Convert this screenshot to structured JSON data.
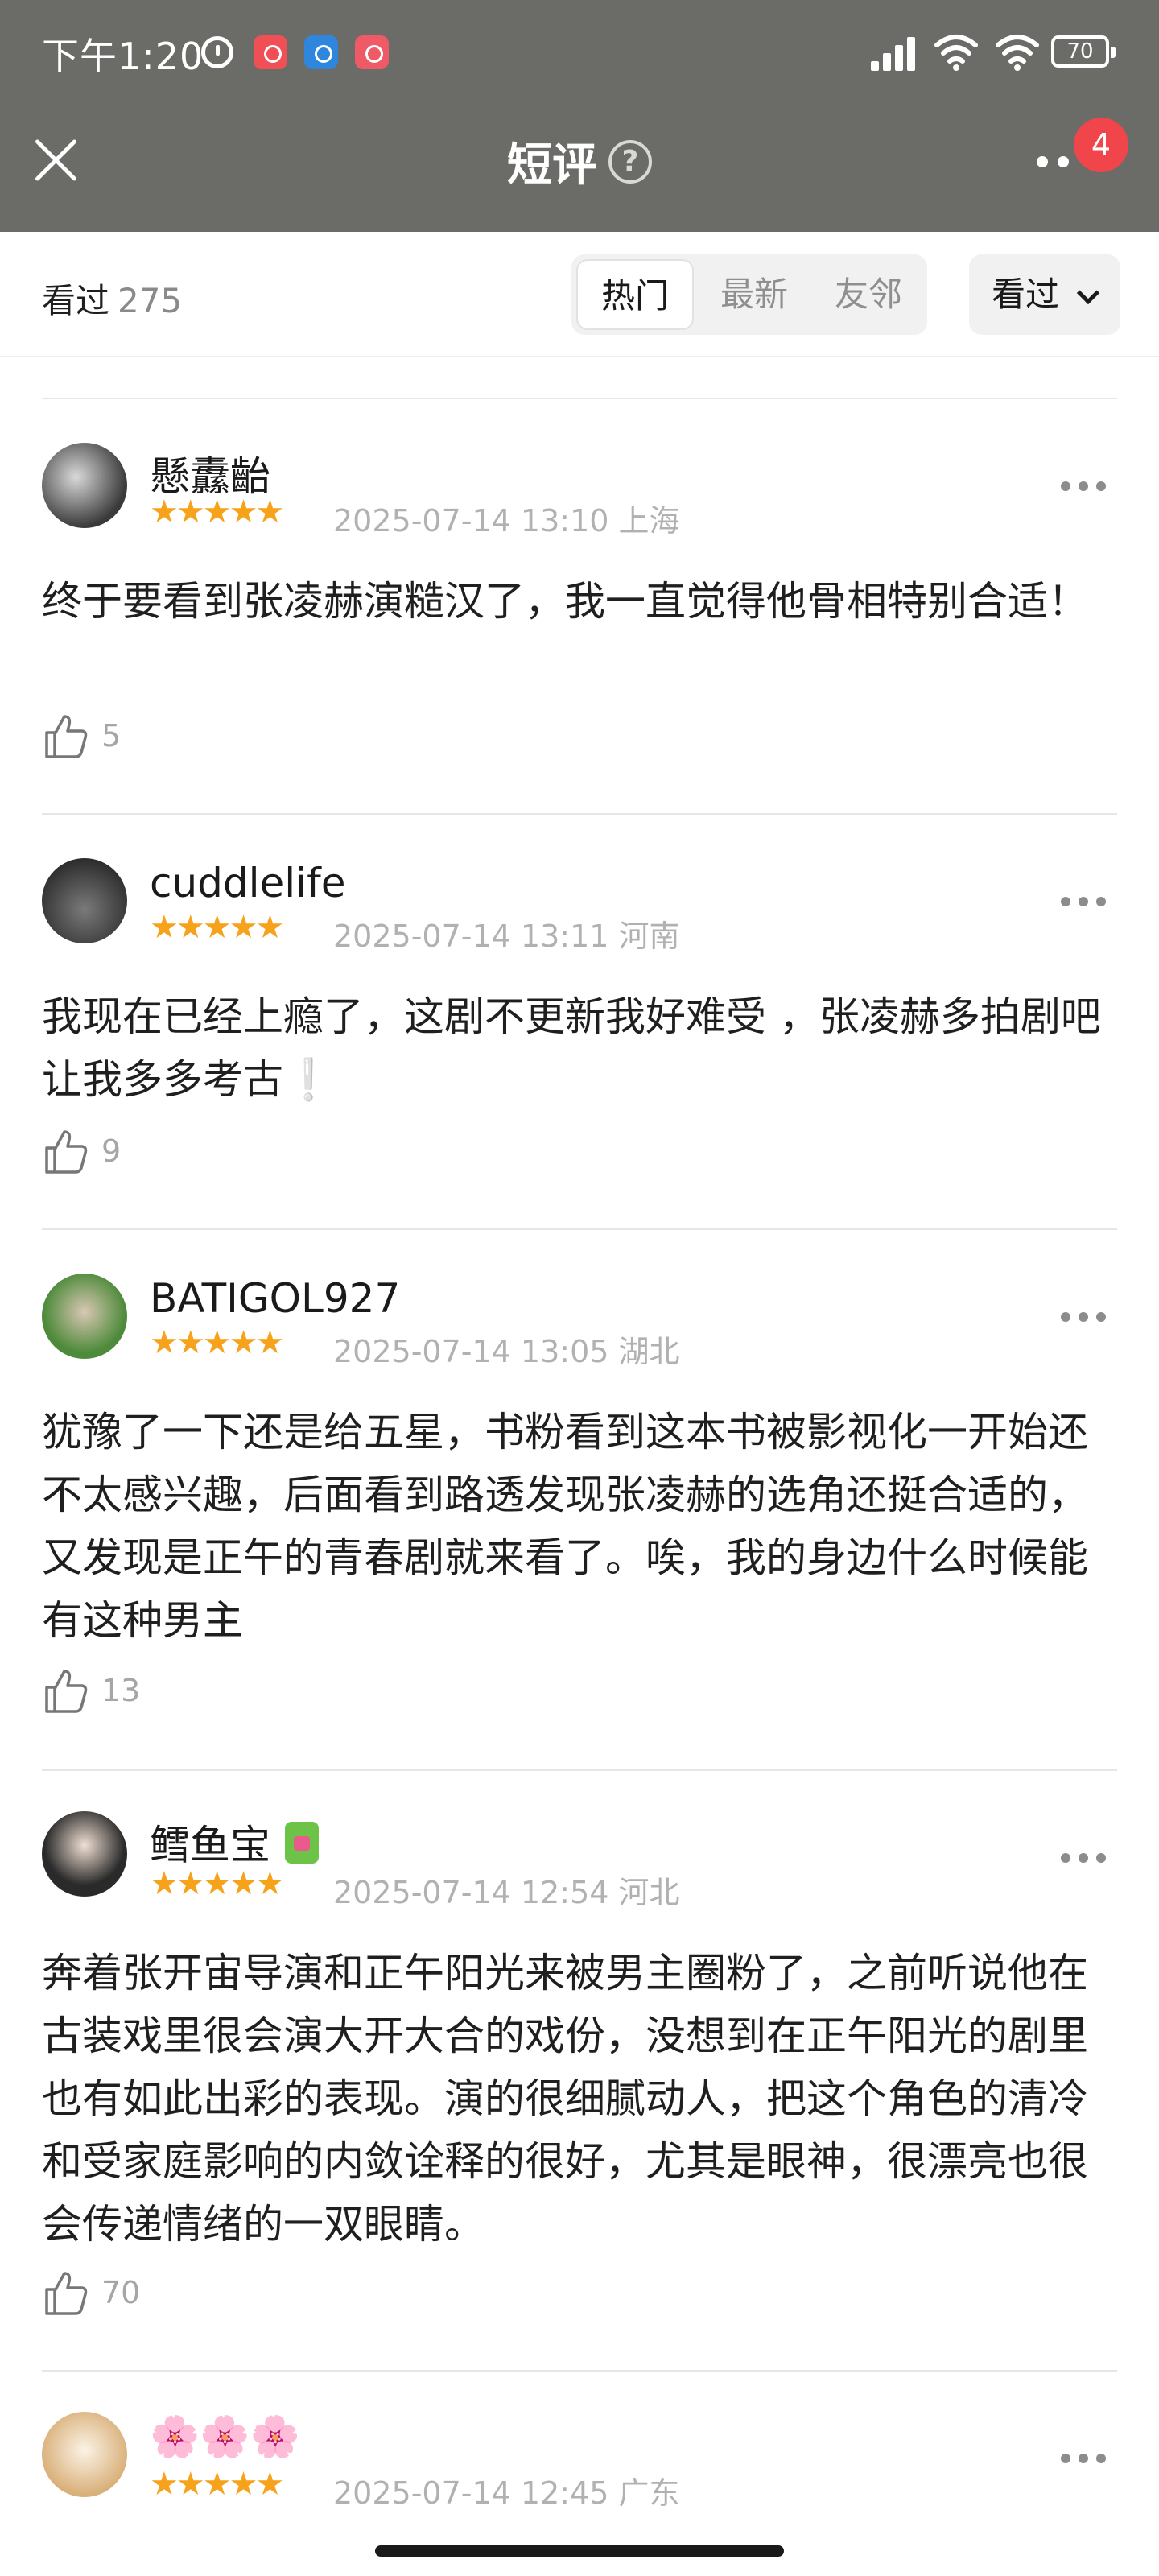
{
  "status_bar": {
    "time": "下午1:20",
    "battery": "70"
  },
  "header": {
    "title": "短评",
    "help_glyph": "?",
    "notification_count": "4"
  },
  "filter": {
    "watched_label": "看过",
    "watched_count": "275",
    "tabs": [
      {
        "label": "热门",
        "active": true
      },
      {
        "label": "最新",
        "active": false
      },
      {
        "label": "友邻",
        "active": false
      }
    ],
    "dropdown_label": "看过"
  },
  "comments": [
    {
      "user": "懸纛齝",
      "stars": "★★★★★",
      "time": "2025-07-14 13:10",
      "location": "上海",
      "text": "终于要看到张凌赫演糙汉了，我一直觉得他骨相特别合适！",
      "likes": "5"
    },
    {
      "user": "cuddlelife",
      "stars": "★★★★★",
      "time": "2025-07-14 13:11",
      "location": "河南",
      "text": "我现在已经上瘾了，这剧不更新我好难受 ，张凌赫多拍剧吧让我多多考古❕",
      "likes": "9"
    },
    {
      "user": "BATIGOL927",
      "stars": "★★★★★",
      "time": "2025-07-14 13:05",
      "location": "湖北",
      "text": "犹豫了一下还是给五星，书粉看到这本书被影视化一开始还不太感兴趣，后面看到路透发现张凌赫的选角还挺合适的，又发现是正午的青春剧就来看了。唉，我的身边什么时候能有这种男主",
      "likes": "13"
    },
    {
      "user": "鳕鱼宝",
      "stars": "★★★★★",
      "time": "2025-07-14 12:54",
      "location": "河北",
      "text": "奔着张开宙导演和正午阳光来被男主圈粉了，之前听说他在古装戏里很会演大开大合的戏份，没想到在正午阳光的剧里也有如此出彩的表现。演的很细腻动人，把这个角色的清冷和受家庭影响的内敛诠释的很好，尤其是眼神，很漂亮也很会传递情绪的一双眼睛。",
      "likes": "70"
    },
    {
      "user": "🌸🌸🌸",
      "stars": "★★★★★",
      "time": "2025-07-14 12:45",
      "location": "广东",
      "text": "",
      "likes": ""
    }
  ]
}
